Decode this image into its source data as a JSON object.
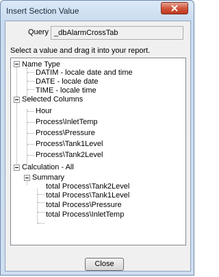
{
  "window": {
    "title": "Insert Section Value"
  },
  "query": {
    "label": "Query",
    "value": "_dbAlarmCrossTab"
  },
  "instruction": "Select a value and drag it into your report.",
  "tree": {
    "name_type": {
      "label": "Name Type",
      "children": [
        "DATIM - locale date and time",
        "DATE - locale date",
        "TIME - locale time"
      ]
    },
    "selected_columns": {
      "label": "Selected Columns",
      "children": [
        "Hour",
        "Process\\InletTemp",
        "Process\\Pressure",
        "Process\\Tank1Level",
        "Process\\Tank2Level"
      ]
    },
    "calculation": {
      "label": "Calculation - All",
      "summary": {
        "label": "Summary",
        "children": [
          "total Process\\Tank2Level",
          "total Process\\Tank1Level",
          "total Process\\Pressure",
          "total Process\\InletTemp"
        ]
      }
    }
  },
  "buttons": {
    "close_label": "Close"
  }
}
